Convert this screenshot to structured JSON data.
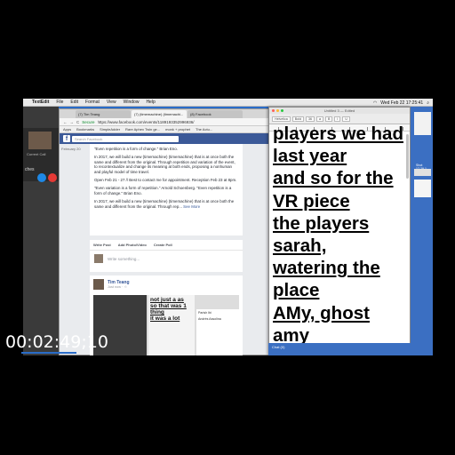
{
  "menubar": {
    "app": "TextEdit",
    "items": [
      "File",
      "Edit",
      "Format",
      "View",
      "Window",
      "Help"
    ],
    "clock": "Wed Feb 22  17:25:41"
  },
  "call": {
    "label": "Current Call",
    "side_text": "ches"
  },
  "browser": {
    "tabs": [
      "(7) Tim Teang",
      "(7) (timemachine) (timemachi...",
      "(8) Facebook"
    ],
    "nav": [
      "←",
      "→",
      "C"
    ],
    "secure_label": "Secure",
    "url": "https://www.facebook.com/events/1189193352996936/",
    "bookmarks": [
      "Apps",
      "Bookmarks",
      "SimpleAdder",
      "Rare Aphex Twin ge...",
      "monk + prophet",
      "The Actu..."
    ]
  },
  "facebook": {
    "logo": "f",
    "search_placeholder": "Search Facebook",
    "left_date": "February 20",
    "post_paragraphs": [
      "\"Even repetition is a form of change.\" Brian Eno.",
      "In 2017, we will build a new (timemachine) (timemachine) that is at once both the same and different from the original. Through repetition and variation of the event, to recontextualize and change its meaning at both ends, proposing a nonhuman and playful model of time travel.",
      "Open Feb 21 - 27 // Best to contact me for appointment. Reception Feb 23 at 8pm.",
      "\"Even variation is a form of repetition.\" Arnold Schoenberg. \"Even repetition is a form of change.\" Brian Eno.",
      "In 2017, we will build a new (timemachine) (timemachine) that is at once both the same and different from the original. Through rep..."
    ],
    "see_more": "See More",
    "compose_actions": [
      "Write Post",
      "Add Photo/Video",
      "Create Poll"
    ],
    "compose_placeholder": "Write something...",
    "feed_name": "Tim Teang",
    "feed_time": "Just now · ☺",
    "feed_mid_text": [
      "not just a as",
      "so that was 1",
      "thing",
      "it was a lot"
    ],
    "feed_right_rows": [
      "Parish Ibi",
      "Andrés Assolina"
    ]
  },
  "textedit": {
    "title": "Untitled 3 — Edited",
    "toolbar": [
      "Helvetica",
      "Bold",
      "36",
      "a",
      "B",
      "I",
      "U"
    ],
    "lines": [
      "players we had",
      "last year",
      "and so for the",
      "VR piece",
      "the players",
      "sarah,",
      "watering the",
      "place",
      "AMy, ghost",
      "amy"
    ]
  },
  "desktop_right": {
    "label": "Shot 17.29.1"
  },
  "bottom_strip": {
    "text": "Chat (0)"
  },
  "timecode": "00:02:49;10",
  "colors": {
    "facebook_blue": "#3b5998",
    "desktop_blue": "#2a6cc8",
    "call_red": "#e53935",
    "call_blue": "#1e88e5"
  }
}
